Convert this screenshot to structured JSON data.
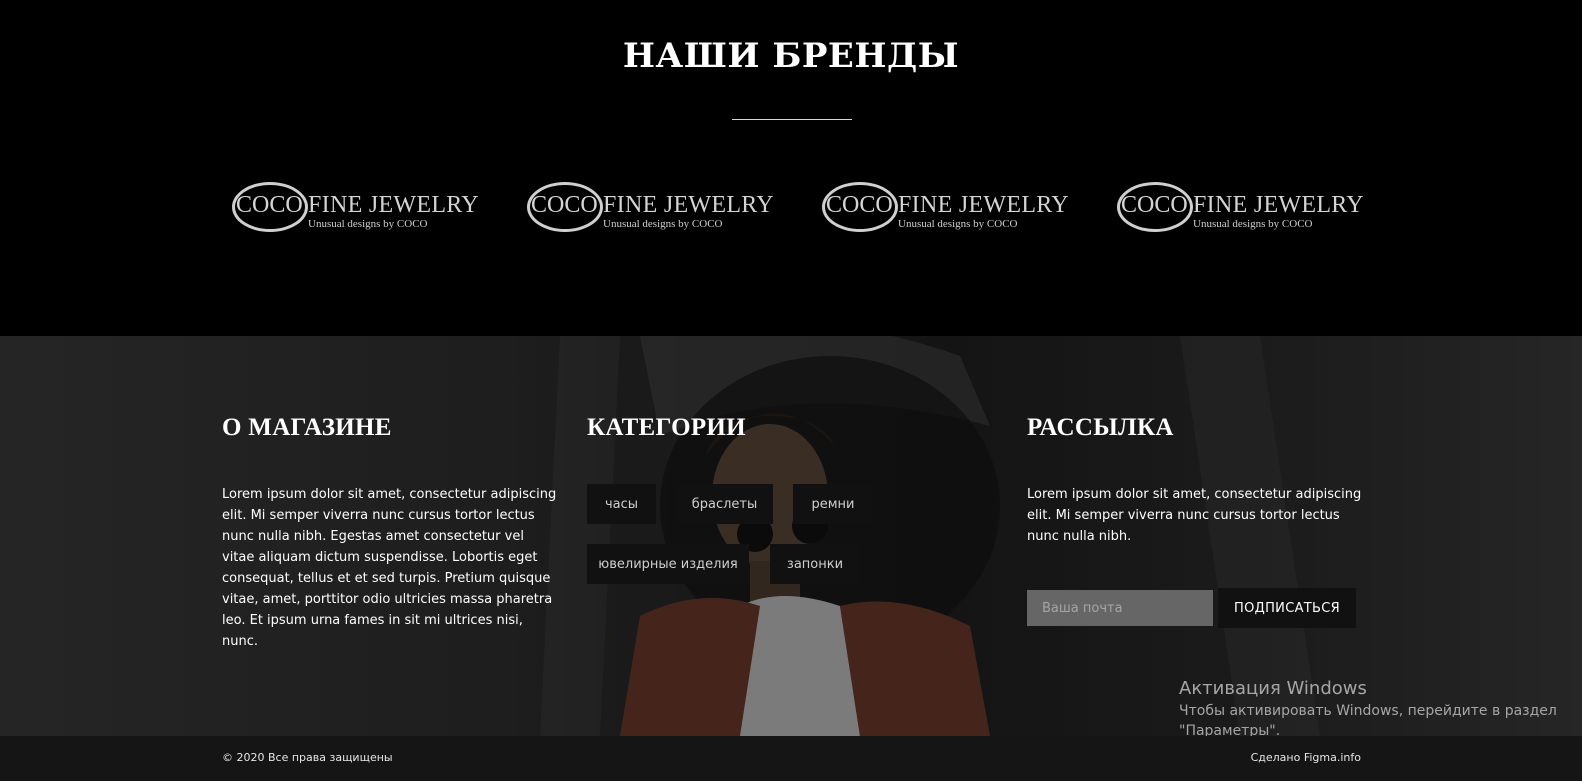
{
  "brands": {
    "title": "НАШИ БРЕНДЫ",
    "logos": [
      {
        "mark": "COCO",
        "name": "FINE JEWELRY",
        "tagline": "Unusual designs by COCO"
      },
      {
        "mark": "COCO",
        "name": "FINE JEWELRY",
        "tagline": "Unusual designs by COCO"
      },
      {
        "mark": "COCO",
        "name": "FINE JEWELRY",
        "tagline": "Unusual designs by COCO"
      },
      {
        "mark": "COCO",
        "name": "FINE JEWELRY",
        "tagline": "Unusual designs by COCO"
      }
    ]
  },
  "footer": {
    "about": {
      "title": "О МАГАЗИНЕ",
      "text": "Lorem ipsum dolor sit amet, consectetur adipiscing elit. Mi semper viverra nunc cursus tortor lectus nunc nulla nibh. Egestas amet consectetur vel vitae aliquam dictum suspendisse. Lobortis eget consequat, tellus et et sed turpis. Pretium quisque vitae, amet, porttitor odio ultricies massa pharetra leo. Et ipsum urna fames in sit mi ultrices nisi, nunc."
    },
    "categories": {
      "title": "КАТЕГОРИИ",
      "tags": [
        "часы",
        "браслеты",
        "ремни",
        "ювелирные изделия",
        "запонки"
      ]
    },
    "newsletter": {
      "title": "РАССЫЛКА",
      "text": "Lorem ipsum dolor sit amet, consectetur adipiscing elit. Mi semper viverra nunc cursus tortor lectus nunc nulla nibh.",
      "email_placeholder": "Ваша почта",
      "email_value": "",
      "subscribe_label": "ПОДПИСАТЬСЯ"
    },
    "windows_activation": {
      "title": "Активация Windows",
      "text": "Чтобы активировать Windows, перейдите в раздел \"Параметры\"."
    },
    "bottom": {
      "copyright": "© 2020 Все права защищены",
      "made_by": "Сделано Figma.info"
    }
  },
  "colors": {
    "background": "#000000",
    "bottom_bar": "#151515",
    "tag_bg": "#111111",
    "input_bg": "#666666"
  }
}
